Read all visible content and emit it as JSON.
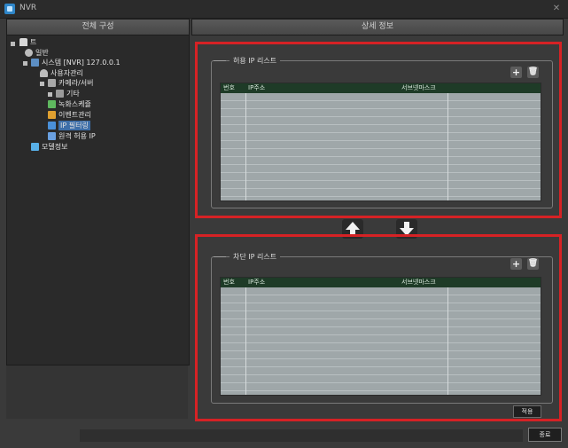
{
  "window": {
    "title": "NVR",
    "close_icon": "close-icon"
  },
  "left_panel": {
    "header": "전체 구성",
    "tree": [
      {
        "label": "트",
        "icon": "home-icon",
        "color": "#e8e8e8"
      },
      {
        "label": "일반",
        "icon": "gear-icon",
        "color": "#c8c8c8"
      },
      {
        "label": "시스템 [NVR] 127.0.0.1",
        "icon": "server-icon",
        "color": "#9cc3e8"
      },
      {
        "label": "사용자관리",
        "icon": "user-icon",
        "color": "#c0c0c0"
      },
      {
        "label": "카메라/서버",
        "icon": "camera-icon",
        "color": "#b0b0b0"
      },
      {
        "label": "기타",
        "icon": "grid-icon",
        "color": "#a8a8a8"
      },
      {
        "label": "녹화스케쥴",
        "icon": "schedule-icon",
        "color": "#5fb85f"
      },
      {
        "label": "이벤트관리",
        "icon": "event-icon",
        "color": "#e0a030"
      },
      {
        "label": "IP 필터링",
        "icon": "filter-icon",
        "color": "#4a90d9"
      },
      {
        "label": "원격 허용 IP",
        "icon": "remote-icon",
        "color": "#6aa0e0"
      },
      {
        "label": "모델정보",
        "icon": "info-icon",
        "color": "#58b0e8"
      }
    ]
  },
  "right_panel": {
    "header": "상세 정보",
    "allow_group": {
      "title": "허용 IP 리스트",
      "columns": [
        "번호",
        "IP주소",
        "서브넷마스크"
      ],
      "rows": 13
    },
    "block_group": {
      "title": "차단 IP 리스트",
      "columns": [
        "번호",
        "IP주소",
        "서브넷마스크"
      ],
      "rows": 13
    },
    "add_icon": "plus-icon",
    "remove_icon": "trash-icon",
    "move_up_icon": "arrow-up-icon",
    "move_down_icon": "arrow-down-icon",
    "apply_label": "적용"
  },
  "footer": {
    "close_label": "종료"
  },
  "colors": {
    "highlight": "#d62225",
    "grid_header": "#1e3b27",
    "grid_body": "#9fa7a9"
  }
}
